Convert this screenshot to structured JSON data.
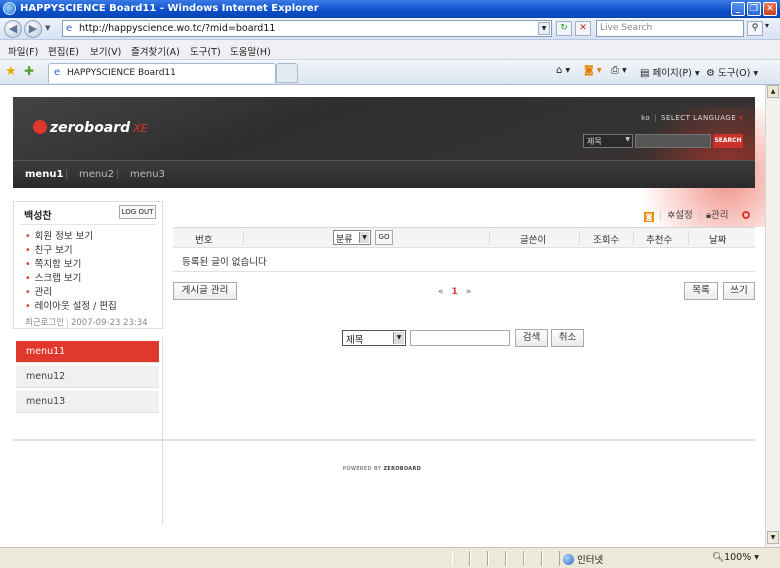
{
  "window": {
    "title": "HAPPYSCIENCE Board11 - Windows Internet Explorer",
    "min": "_",
    "max": "❐",
    "close": "✕"
  },
  "address": {
    "url": "http://happyscience.wo.tc/?mid=board11",
    "search_placeholder": "Live Search"
  },
  "menubar": [
    "파일(F)",
    "편집(E)",
    "보기(V)",
    "즐겨찾기(A)",
    "도구(T)",
    "도움말(H)"
  ],
  "tab": {
    "label": "HAPPYSCIENCE Board11"
  },
  "commandbar": {
    "page": "페이지(P)",
    "tools": "도구(O)"
  },
  "site": {
    "logo": "zeroboard",
    "logo_suffix": "XE",
    "lang_code": "ko",
    "lang_label": "SELECT LANGUAGE",
    "search_select": "제목",
    "search_button": "SEARCH",
    "gnb": [
      "menu1",
      "menu2",
      "menu3"
    ]
  },
  "login": {
    "name": "백성찬",
    "logout": "LOG OUT",
    "menu": [
      "회원 정보 보기",
      "친구 보기",
      "쪽지함 보기",
      "스크랩 보기",
      "관리",
      "레이아웃 설정 / 편집"
    ],
    "last_login_label": "최근로그인",
    "last_login_time": "2007-09-23 23:34"
  },
  "submenu": [
    "menu11",
    "menu12",
    "menu13"
  ],
  "board": {
    "tools": {
      "settings": "설정",
      "admin": "관리"
    },
    "columns": {
      "no": "번호",
      "category": "분류",
      "go": "GO",
      "author": "글쓴이",
      "views": "조회수",
      "votes": "추천수",
      "date": "날짜"
    },
    "empty_message": "등록된 글이 없습니다",
    "manage_button": "게시글 관리",
    "pager": {
      "first": "«",
      "current": "1",
      "last": "»"
    },
    "list_button": "목록",
    "write_button": "쓰기",
    "search": {
      "select": "제목",
      "submit": "검색",
      "cancel": "취소"
    }
  },
  "footer": {
    "powered_by": "POWERED BY",
    "brand": "ZEROBOARD"
  },
  "status": {
    "zone": "인터넷",
    "zoom": "100%"
  }
}
